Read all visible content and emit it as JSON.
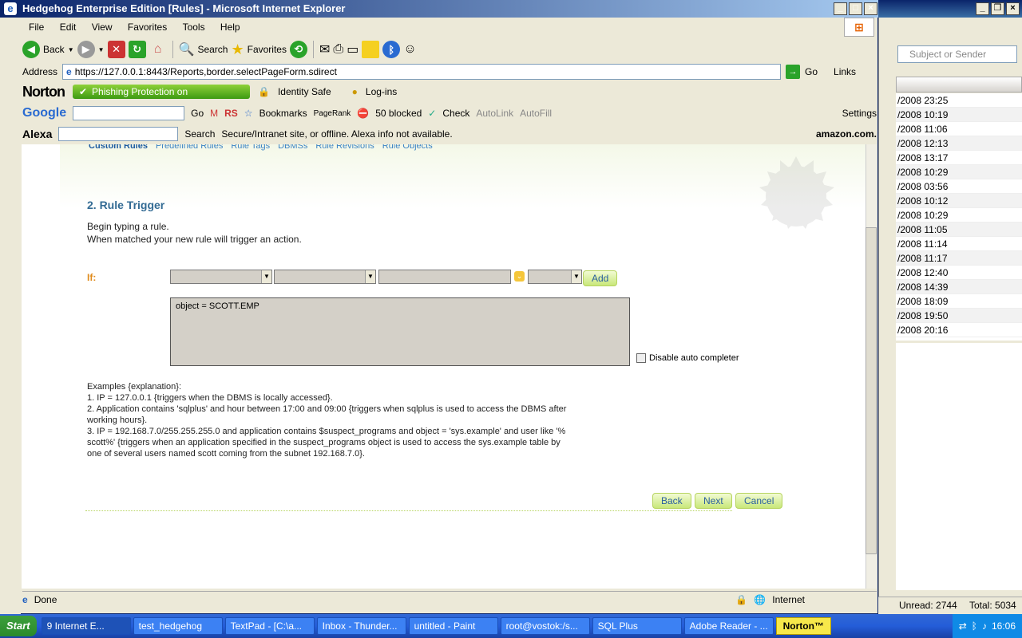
{
  "window": {
    "title": "Hedgehog Enterprise Edition [Rules] - Microsoft Internet Explorer"
  },
  "menu": [
    "File",
    "Edit",
    "View",
    "Favorites",
    "Tools",
    "Help"
  ],
  "toolbar": {
    "back": "Back",
    "search": "Search",
    "favorites": "Favorites"
  },
  "address": {
    "label": "Address",
    "url": "https://127.0.0.1:8443/Reports,border.selectPageForm.sdirect",
    "go": "Go",
    "links": "Links"
  },
  "norton": {
    "logo": "Norton",
    "phishing": "Phishing Protection on",
    "identity": "Identity Safe",
    "login": "Log-ins"
  },
  "google": {
    "logo": "Google",
    "go": "Go",
    "bookmarks": "Bookmarks",
    "pagerank": "PageRank",
    "blocked": "50 blocked",
    "check": "Check",
    "autolink": "AutoLink",
    "autofill": "AutoFill",
    "settings": "Settings"
  },
  "alexa": {
    "logo": "Alexa",
    "search": "Search",
    "info": "Secure/Intranet site, or offline. Alexa info not available.",
    "amazon": "amazon.com."
  },
  "subnav": [
    "Custom Rules",
    "Predefined Rules",
    "Rule Tags",
    "DBMSs",
    "Rule Revisions",
    "Rule Objects"
  ],
  "page": {
    "section_title": "2. Rule Trigger",
    "intro1": "Begin typing a rule.",
    "intro2": "When matched your new rule will trigger an action.",
    "if_label": "If:",
    "add_button": "Add",
    "rule_text": "object = SCOTT.EMP",
    "disable_autocompleter": "Disable auto completer",
    "examples": [
      "Examples {explanation}:",
      "1. IP = 127.0.0.1 {triggers when the DBMS is locally accessed}.",
      "2. Application contains 'sqlplus' and hour between 17:00 and 09:00 {triggers when sqlplus is used to access the DBMS after working hours}.",
      "3. IP = 192.168.7.0/255.255.255.0 and application contains $suspect_programs and object = 'sys.example' and user like '% scott%' {triggers when an application specified in the suspect_programs object is used to access the sys.example table by one of several users named scott coming from the subnet 192.168.7.0}."
    ],
    "back_button": "Back",
    "next_button": "Next",
    "cancel_button": "Cancel"
  },
  "status": {
    "done": "Done",
    "zone": "Internet"
  },
  "bg_window": {
    "search_placeholder": "Subject or Sender",
    "dates": [
      "/2008 23:25",
      "/2008 10:19",
      "/2008 11:06",
      "/2008 12:13",
      "/2008 13:17",
      "/2008 10:29",
      "/2008 03:56",
      "/2008 10:12",
      "/2008 10:29",
      "/2008 11:05",
      "/2008 11:14",
      "/2008 11:17",
      "/2008 12:40",
      "/2008 14:39",
      "/2008 18:09",
      "/2008 19:50",
      "/2008 20:16"
    ],
    "unread": "Unread: 2744",
    "total": "Total: 5034"
  },
  "taskbar": {
    "start": "Start",
    "tasks": [
      "9 Internet E...",
      "test_hedgehog",
      "TextPad - [C:\\a...",
      "Inbox - Thunder...",
      "untitled - Paint",
      "root@vostok:/s...",
      "SQL Plus",
      "Adobe Reader - ..."
    ],
    "norton": "Norton™",
    "clock": "16:06"
  }
}
